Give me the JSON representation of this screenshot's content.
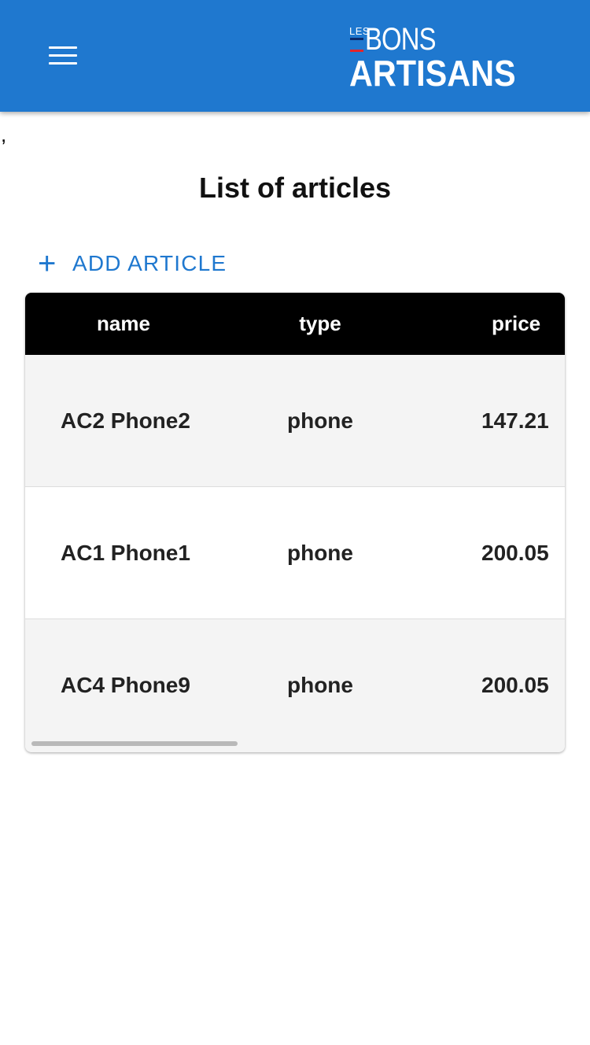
{
  "appbar": {
    "menu_icon": "hamburger-menu-icon",
    "logo": {
      "les": "LES",
      "bons": "BONS",
      "artisans": "ARTISANS"
    }
  },
  "stray_text": ",",
  "page": {
    "title": "List of articles",
    "add_button": {
      "icon": "plus-icon",
      "label": "ADD ARTICLE"
    }
  },
  "table": {
    "headers": {
      "name": "name",
      "type": "type",
      "price": "price"
    },
    "rows": [
      {
        "name": "AC2 Phone2",
        "type": "phone",
        "price": "147.21"
      },
      {
        "name": "AC1 Phone1",
        "type": "phone",
        "price": "200.05"
      },
      {
        "name": "AC4 Phone9",
        "type": "phone",
        "price": "200.05"
      }
    ]
  },
  "colors": {
    "appbar": "#1f78cf",
    "accent": "#1f78cf",
    "header_bg": "#000000",
    "row_alt": "#f4f4f4"
  }
}
